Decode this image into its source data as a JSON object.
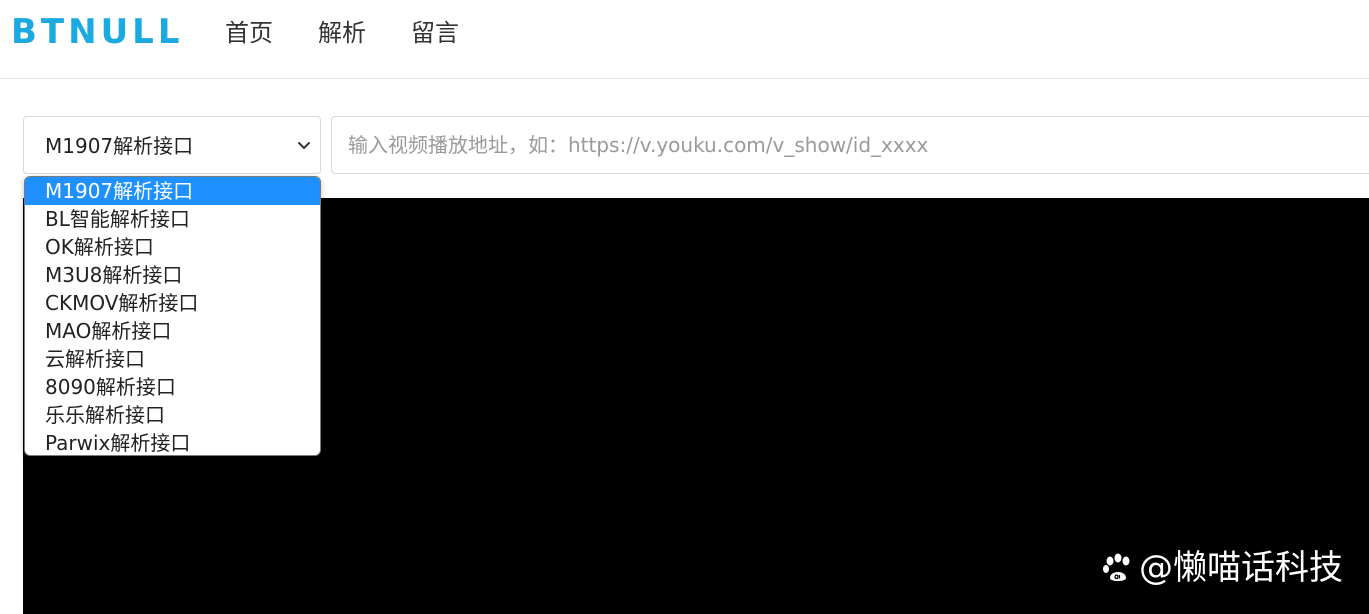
{
  "brand": "BTNULL",
  "nav": {
    "home": "首页",
    "parse": "解析",
    "message": "留言"
  },
  "select": {
    "value": "M1907解析接口",
    "options": [
      "M1907解析接口",
      "BL智能解析接口",
      "OK解析接口",
      "M3U8解析接口",
      "CKMOV解析接口",
      "MAO解析接口",
      "云解析接口",
      "8090解析接口",
      "乐乐解析接口",
      "Parwix解析接口"
    ]
  },
  "url_input": {
    "value": "",
    "placeholder": "输入视频播放地址，如：https://v.youku.com/v_show/id_xxxx"
  },
  "watermark": {
    "text": "@懒喵话科技",
    "icon": "paw-icon"
  },
  "colors": {
    "brand": "#1ba9e2",
    "selected_option": "#1e90ff",
    "player_bg": "#000000"
  }
}
